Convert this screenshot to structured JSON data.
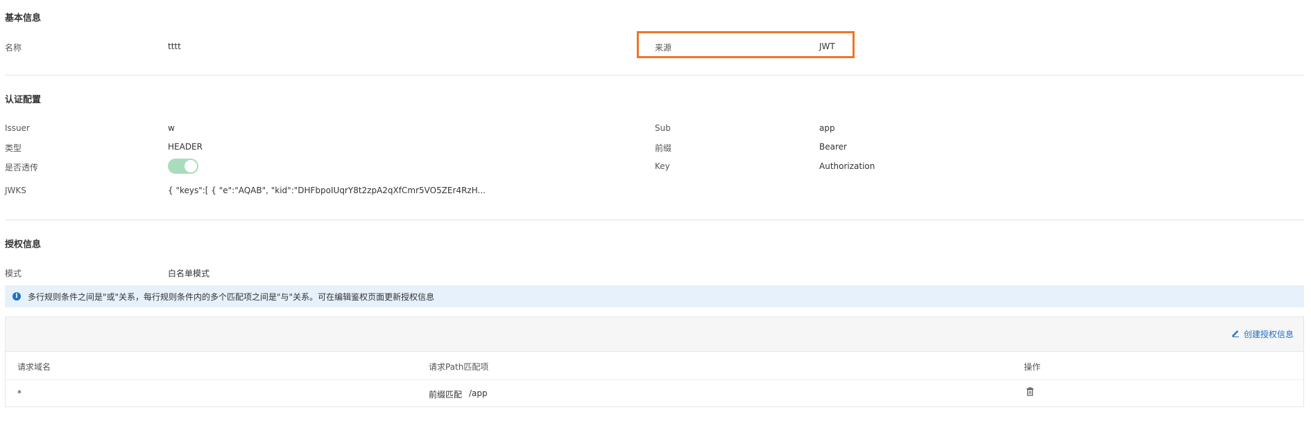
{
  "basic_info": {
    "title": "基本信息",
    "name_label": "名称",
    "name_value": "tttt",
    "source_label": "来源",
    "source_value": "JWT"
  },
  "auth_config": {
    "title": "认证配置",
    "issuer_label": "Issuer",
    "issuer_value": "w",
    "type_label": "类型",
    "type_value": "HEADER",
    "passthrough_label": "是否透传",
    "passthrough_enabled": true,
    "jwks_label": "JWKS",
    "jwks_value": "{ \"keys\":[ { \"e\":\"AQAB\", \"kid\":\"DHFbpoIUqrY8t2zpA2qXfCmr5VO5ZEr4RzH...",
    "sub_label": "Sub",
    "sub_value": "app",
    "prefix_label": "前缀",
    "prefix_value": "Bearer",
    "key_label": "Key",
    "key_value": "Authorization"
  },
  "authz_info": {
    "title": "授权信息",
    "mode_label": "模式",
    "mode_value": "白名单模式",
    "info_icon": "info-icon",
    "info_text": "多行规则条件之间是\"或\"关系，每行规则条件内的多个匹配项之间是\"与\"关系。可在编辑鉴权页面更新授权信息",
    "create_icon": "edit-icon",
    "create_label": "创建授权信息",
    "columns": [
      "请求域名",
      "请求Path匹配项",
      "操作"
    ],
    "rows": [
      {
        "domain": "*",
        "match_type": "前缀匹配",
        "path": "/app",
        "action_icon": "trash-icon"
      }
    ]
  },
  "colors": {
    "highlight": "#ef7524",
    "accent": "#1f6fc5",
    "toggle_on": "#a9dcbc",
    "banner_bg": "#e6f1fb"
  }
}
